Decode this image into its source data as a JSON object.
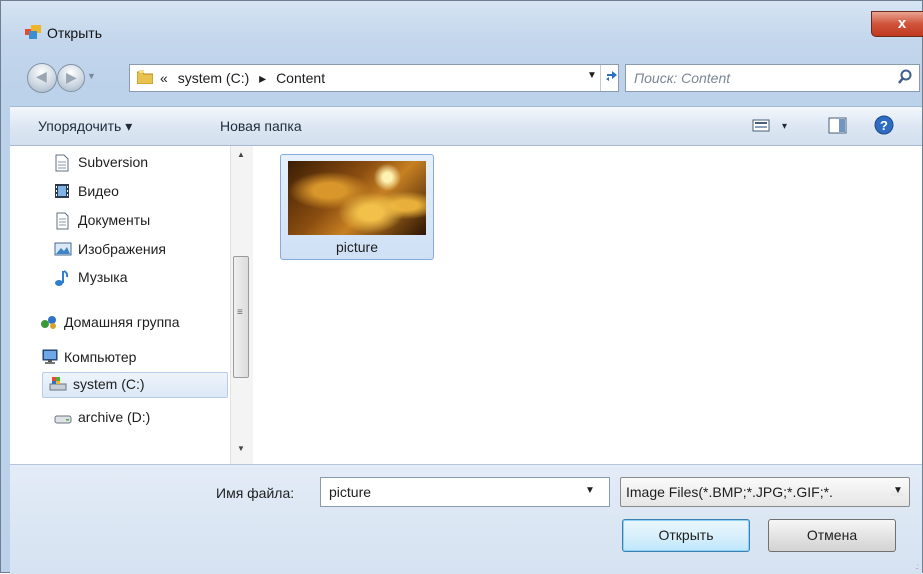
{
  "window": {
    "title": "Открыть",
    "close_label": "x"
  },
  "nav": {
    "address_prefix": "«",
    "address_parts": [
      "system (C:)",
      "Content"
    ],
    "address_separator": "▸",
    "search_placeholder": "Поиск: Content"
  },
  "toolbar": {
    "organize_label": "Упорядочить ▾",
    "new_folder_label": "Новая папка",
    "view_dropdown": "▾"
  },
  "sidebar": {
    "items": [
      {
        "label": "Subversion",
        "icon": "document-icon"
      },
      {
        "label": "Видео",
        "icon": "video-icon"
      },
      {
        "label": "Документы",
        "icon": "documents-icon"
      },
      {
        "label": "Изображения",
        "icon": "images-icon"
      },
      {
        "label": "Музыка",
        "icon": "music-icon"
      },
      {
        "label": "Домашняя группа",
        "icon": "homegroup-icon"
      },
      {
        "label": "Компьютер",
        "icon": "computer-icon"
      },
      {
        "label": "system (C:)",
        "icon": "drive-c-icon",
        "selected": true
      },
      {
        "label": "archive (D:)",
        "icon": "drive-d-icon"
      }
    ]
  },
  "files": [
    {
      "name": "picture",
      "selected": true
    }
  ],
  "footer": {
    "filename_label": "Имя файла:",
    "filename_value": "picture",
    "filter_value": "Image Files(*.BMP;*.JPG;*.GIF;*.",
    "open_label": "Открыть",
    "cancel_label": "Отмена"
  },
  "colors": {
    "accent": "#3c7fb1",
    "selection": "#cfe0f5",
    "close": "#c0391f"
  }
}
